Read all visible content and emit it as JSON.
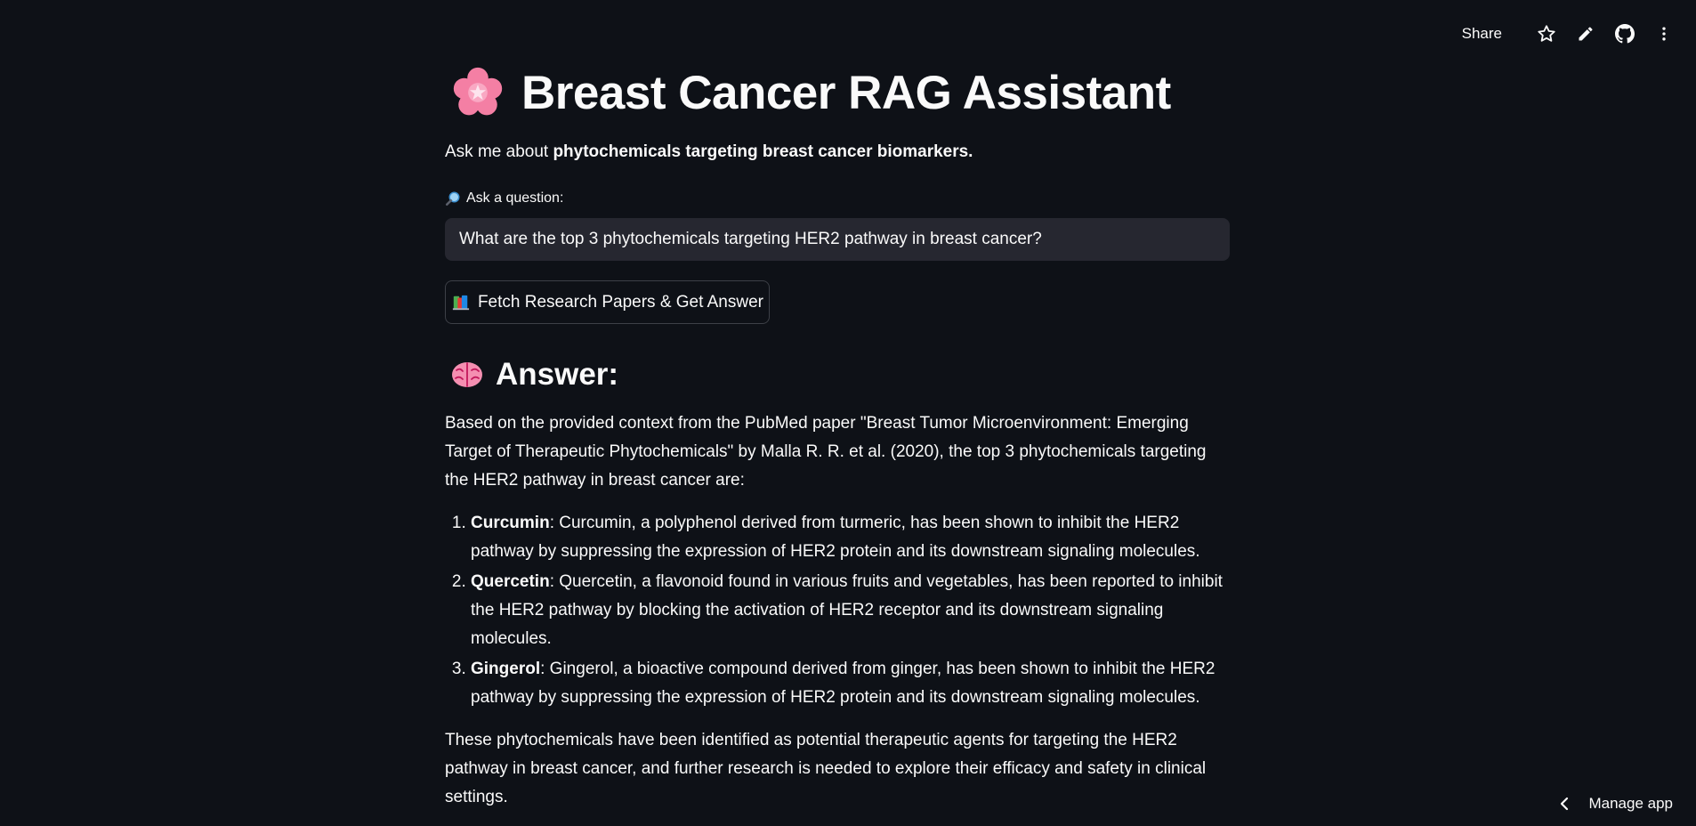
{
  "toolbar": {
    "share_label": "Share",
    "icons": [
      "star-icon",
      "pencil-icon",
      "github-icon",
      "more-vertical-icon"
    ]
  },
  "page": {
    "title_emoji": "cherry-blossom-icon",
    "title": "Breast Cancer RAG Assistant",
    "subtitle_prefix": "Ask me about ",
    "subtitle_bold": "phytochemicals targeting breast cancer biomarkers."
  },
  "question": {
    "label_icon": "magnifier-icon",
    "label": "Ask a question:",
    "value": "What are the top 3 phytochemicals targeting HER2 pathway in breast cancer?"
  },
  "fetch_button": {
    "icon": "books-icon",
    "label": "Fetch Research Papers & Get Answer"
  },
  "answer": {
    "heading_icon": "brain-icon",
    "heading": "Answer:",
    "intro": "Based on the provided context from the PubMed paper \"Breast Tumor Microenvironment: Emerging Target of Therapeutic Phytochemicals\" by Malla R. R. et al. (2020), the top 3 phytochemicals targeting the HER2 pathway in breast cancer are:",
    "items": [
      {
        "name": "Curcumin",
        "text": ": Curcumin, a polyphenol derived from turmeric, has been shown to inhibit the HER2 pathway by suppressing the expression of HER2 protein and its downstream signaling molecules."
      },
      {
        "name": "Quercetin",
        "text": ": Quercetin, a flavonoid found in various fruits and vegetables, has been reported to inhibit the HER2 pathway by blocking the activation of HER2 receptor and its downstream signaling molecules."
      },
      {
        "name": "Gingerol",
        "text": ": Gingerol, a bioactive compound derived from ginger, has been shown to inhibit the HER2 pathway by suppressing the expression of HER2 protein and its downstream signaling molecules."
      }
    ],
    "conclusion": "These phytochemicals have been identified as potential therapeutic agents for targeting the HER2 pathway in breast cancer, and further research is needed to explore their efficacy and safety in clinical settings."
  },
  "manage_app": {
    "label": "Manage app"
  },
  "colors": {
    "background": "#0e1117",
    "text": "#fafafa",
    "input_bg": "#262730",
    "button_border": "#3d4047"
  }
}
